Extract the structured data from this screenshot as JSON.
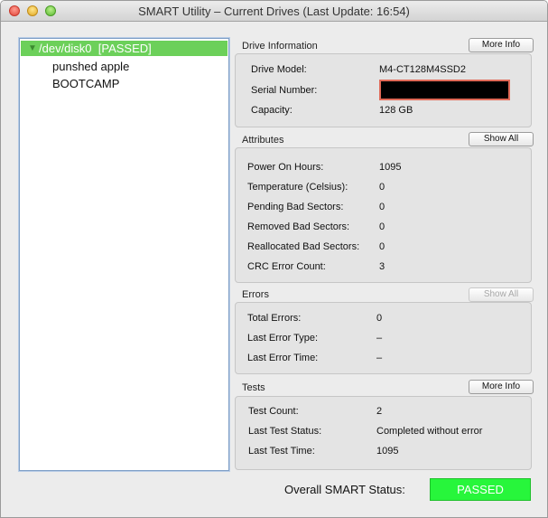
{
  "window": {
    "title": "SMART Utility – Current Drives (Last Update: 16:54)"
  },
  "sidebar": {
    "root": {
      "arrow": "▼",
      "label": "/dev/disk0  [PASSED]"
    },
    "children": [
      "punshed apple",
      "BOOTCAMP"
    ]
  },
  "drive_info": {
    "title": "Drive Information",
    "button": "More Info",
    "rows": [
      {
        "label": "Drive Model:",
        "value": "M4-CT128M4SSD2"
      },
      {
        "label": "Serial Number:",
        "value": ""
      },
      {
        "label": "Capacity:",
        "value": "128 GB"
      }
    ]
  },
  "attributes": {
    "title": "Attributes",
    "button": "Show All",
    "rows": [
      {
        "label": "Power On Hours:",
        "value": "1095"
      },
      {
        "label": "Temperature (Celsius):",
        "value": "0"
      },
      {
        "label": "Pending Bad Sectors:",
        "value": "0"
      },
      {
        "label": "Removed Bad Sectors:",
        "value": "0"
      },
      {
        "label": "Reallocated Bad Sectors:",
        "value": "0"
      },
      {
        "label": "CRC Error Count:",
        "value": "3"
      }
    ]
  },
  "errors": {
    "title": "Errors",
    "button": "Show All",
    "rows": [
      {
        "label": "Total Errors:",
        "value": "0"
      },
      {
        "label": "Last Error Type:",
        "value": "–"
      },
      {
        "label": "Last Error Time:",
        "value": "–"
      }
    ]
  },
  "tests": {
    "title": "Tests",
    "button": "More Info",
    "rows": [
      {
        "label": "Test Count:",
        "value": "2"
      },
      {
        "label": "Last Test Status:",
        "value": "Completed without error"
      },
      {
        "label": "Last Test Time:",
        "value": "1095"
      }
    ]
  },
  "overall": {
    "label": "Overall SMART Status:",
    "status": "PASSED"
  }
}
